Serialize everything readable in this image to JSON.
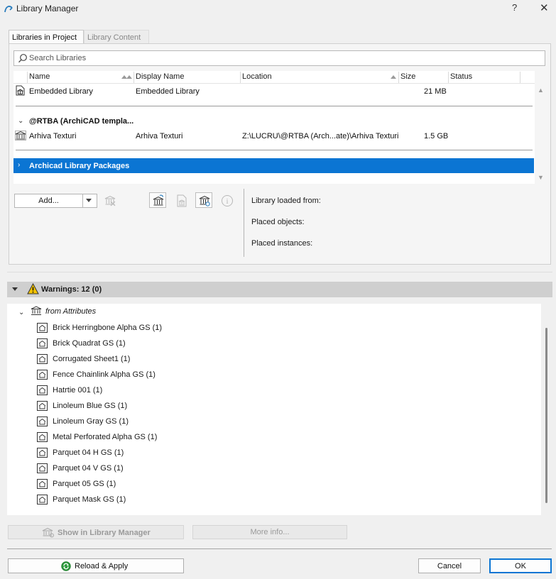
{
  "window": {
    "title": "Library Manager",
    "help_label": "?",
    "close_label": "✕"
  },
  "tabs": [
    {
      "label": "Libraries in Project",
      "active": true
    },
    {
      "label": "Library Content",
      "active": false
    }
  ],
  "search": {
    "placeholder": "Search Libraries",
    "value": ""
  },
  "library_table": {
    "columns": [
      "Name",
      "Display Name",
      "Location",
      "Size",
      "Status"
    ],
    "rows": [
      {
        "name": "Embedded Library",
        "display_name": "Embedded Library",
        "location": "",
        "size": "21 MB",
        "status": ""
      },
      {
        "group": "@RTBA (ArchiCAD templa..."
      },
      {
        "name": "Arhiva Texturi",
        "display_name": "Arhiva Texturi",
        "location": "Z:\\LUCRU\\@RTBA (Arch...ate)\\Arhiva Texturi",
        "size": "1.5 GB",
        "status": ""
      }
    ],
    "packages_label": "Archicad Library Packages"
  },
  "toolbar": {
    "add_label": "Add...",
    "info_glyph": "i"
  },
  "info_panel": {
    "loaded_from": "Library loaded from:",
    "placed_objects": "Placed objects:",
    "placed_instances": "Placed instances:"
  },
  "warnings": {
    "header": "Warnings: 12 (0)",
    "group_label": "from Attributes",
    "items": [
      "Brick Herringbone Alpha GS (1)",
      "Brick Quadrat GS (1)",
      "Corrugated Sheet1 (1)",
      "Fence Chainlink Alpha GS (1)",
      "Hatrtie 001 (1)",
      "Linoleum Blue GS (1)",
      "Linoleum Gray GS (1)",
      "Metal Perforated Alpha GS (1)",
      "Parquet 04 H GS (1)",
      "Parquet 04 V GS (1)",
      "Parquet 05 GS (1)",
      "Parquet Mask GS (1)"
    ]
  },
  "buttons": {
    "show_in_manager": "Show in Library Manager",
    "more_info": "More info...",
    "reload_apply": "Reload & Apply",
    "cancel": "Cancel",
    "ok": "OK"
  },
  "colors": {
    "accent": "#0b75d3",
    "warning": "#f5c400"
  }
}
